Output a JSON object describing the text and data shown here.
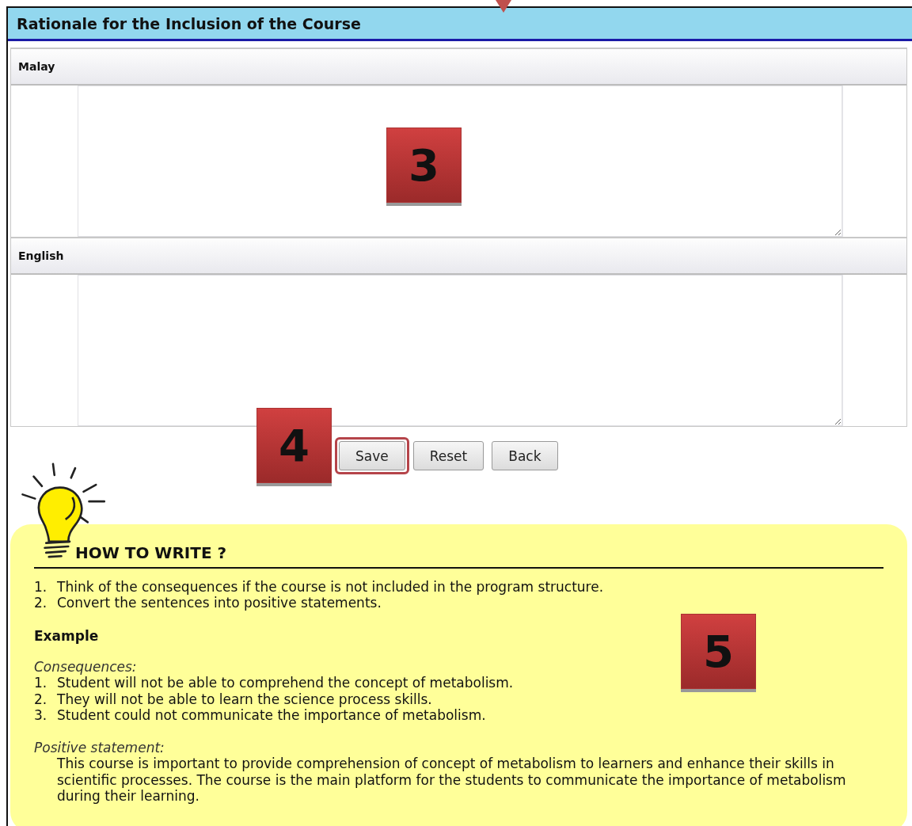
{
  "header": {
    "title": "Rationale for the Inclusion of the Course"
  },
  "sections": [
    {
      "label": "Malay"
    },
    {
      "label": "English"
    }
  ],
  "buttons": [
    {
      "label": "Save",
      "highlighted": true
    },
    {
      "label": "Reset",
      "highlighted": false
    },
    {
      "label": "Back",
      "highlighted": false
    }
  ],
  "callouts": [
    {
      "number": "3"
    },
    {
      "number": "4"
    },
    {
      "number": "5"
    }
  ],
  "guide": {
    "title": "HOW TO WRITE ?",
    "steps": [
      {
        "number": "1.",
        "text": "Think of the consequences if the course is not included in the program structure."
      },
      {
        "number": "2.",
        "text": "Convert the sentences into positive statements."
      }
    ],
    "example_heading": "Example",
    "consequences_label": "Consequences:",
    "consequences": [
      {
        "number": "1.",
        "text": "Student will not be able to comprehend the concept of metabolism."
      },
      {
        "number": "2.",
        "text": "They will not be able to learn the science process skills."
      },
      {
        "number": "3.",
        "text": "Student could not communicate the importance of metabolism."
      }
    ],
    "positive_label": "Positive statement:",
    "positive_text": "This course is important to provide comprehension of concept of metabolism to learners and enhance their skills in scientific processes. The course is the main platform for the students to communicate the importance of metabolism during their learning."
  }
}
